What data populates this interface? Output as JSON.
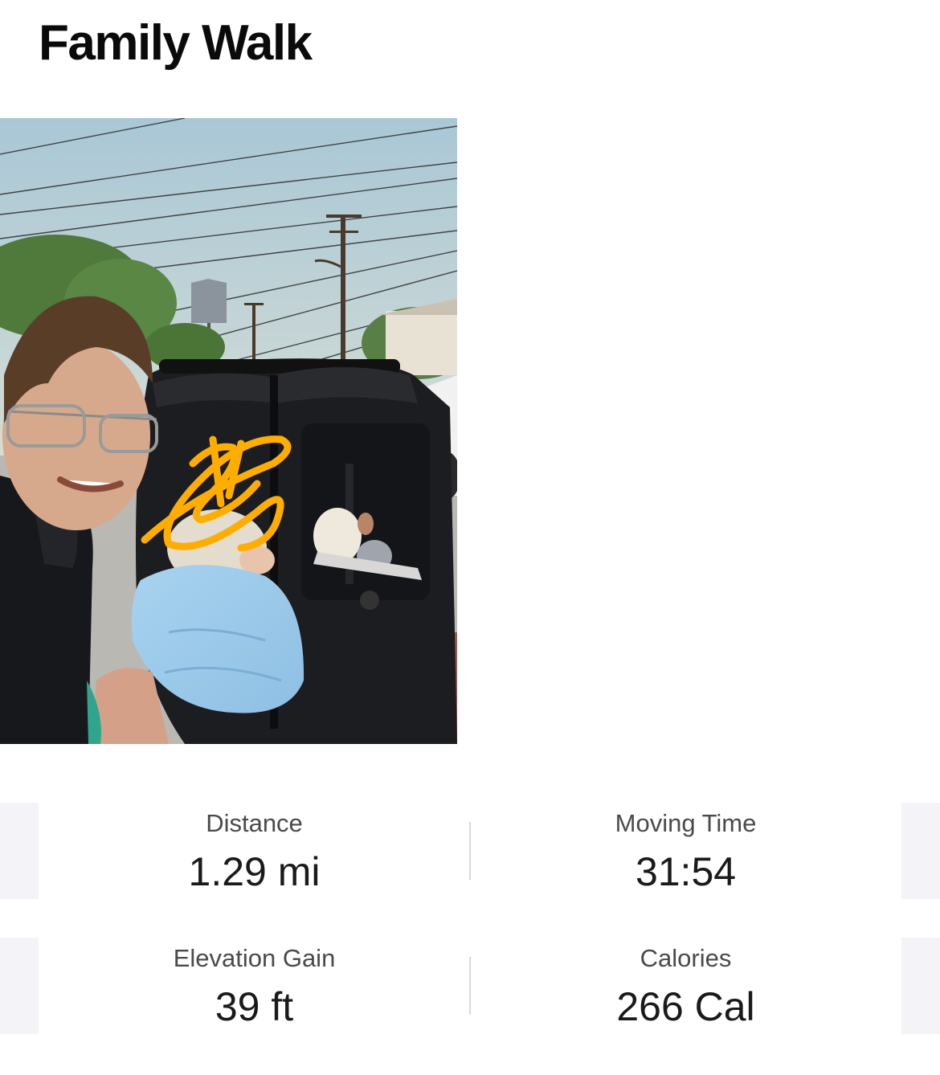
{
  "activity": {
    "title": "Family Walk"
  },
  "photo": {
    "description_icon": "activity-photo"
  },
  "stats": [
    {
      "label": "Distance",
      "value": "1.29 mi"
    },
    {
      "label": "Moving Time",
      "value": "31:54"
    },
    {
      "label": "Elevation Gain",
      "value": "39 ft"
    },
    {
      "label": "Calories",
      "value": "266 Cal"
    }
  ],
  "colors": {
    "background": "#ffffff",
    "strip": "#f4f3f8",
    "divider": "#d8d8dc",
    "label": "#4a4a4a",
    "value": "#1a1a1a",
    "scribble": "#ffad00"
  }
}
